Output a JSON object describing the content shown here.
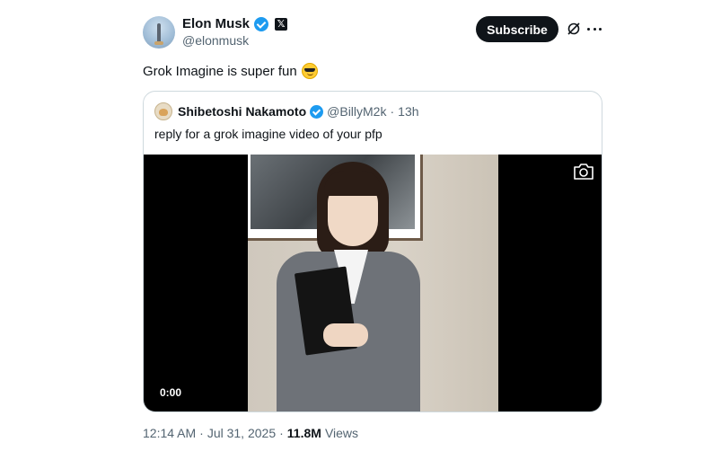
{
  "author": {
    "name": "Elon Musk",
    "handle": "@elonmusk",
    "affiliate_badge": "𝕏"
  },
  "actions": {
    "subscribe_label": "Subscribe"
  },
  "tweet": {
    "text": "Grok Imagine is super fun"
  },
  "quote": {
    "name": "Shibetoshi Nakamoto",
    "handle": "@BillyM2k",
    "separator": "·",
    "time": "13h",
    "text": "reply for a grok imagine video of your pfp"
  },
  "video": {
    "timestamp": "0:00"
  },
  "footer": {
    "time": "12:14 AM",
    "separator": "·",
    "date": "Jul 31, 2025",
    "separator2": "·",
    "views_count": "11.8M",
    "views_label": "Views"
  },
  "colors": {
    "accent": "#1d9bf0",
    "text_primary": "#0f1419",
    "text_secondary": "#536471",
    "border": "#cfd9de"
  },
  "icons": {
    "verified": "verified-badge-icon",
    "grok": "grok-icon",
    "more": "more-icon",
    "camera": "camera-icon",
    "emoji": "smiling-face-with-sunglasses-emoji"
  }
}
